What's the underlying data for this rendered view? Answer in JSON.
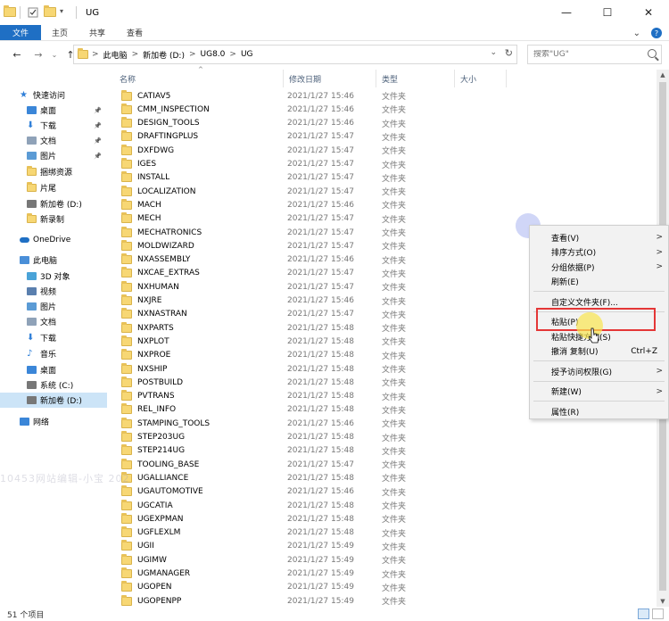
{
  "window": {
    "title": "UG",
    "minimize": "—",
    "maximize": "☐",
    "close": "✕"
  },
  "ribbon": {
    "tabs": [
      "文件",
      "主页",
      "共享",
      "查看"
    ],
    "expand": "⌄",
    "help": "?"
  },
  "address": {
    "crumbs": [
      "此电脑",
      "新加卷 (D:)",
      "UG8.0",
      "UG"
    ],
    "sep": ">",
    "search_placeholder": "搜索\"UG\""
  },
  "nav": {
    "items": [
      {
        "label": "快速访问",
        "icon": "star-icon",
        "pinned": false
      },
      {
        "label": "桌面",
        "icon": "desktop-icon",
        "pinned": true
      },
      {
        "label": "下载",
        "icon": "download-icon",
        "pinned": true
      },
      {
        "label": "文档",
        "icon": "document-icon",
        "pinned": true
      },
      {
        "label": "图片",
        "icon": "picture-icon",
        "pinned": true
      },
      {
        "label": "捆绑资源",
        "icon": "folder-icon",
        "pinned": false
      },
      {
        "label": "片尾",
        "icon": "folder-icon",
        "pinned": false
      },
      {
        "label": "新加卷 (D:)",
        "icon": "drive-icon",
        "pinned": false
      },
      {
        "label": "新录制",
        "icon": "folder-icon",
        "pinned": false
      },
      {
        "label": "OneDrive",
        "icon": "cloud-icon",
        "pinned": false
      },
      {
        "label": "此电脑",
        "icon": "computer-icon",
        "pinned": false
      },
      {
        "label": "3D 对象",
        "icon": "cube-icon",
        "pinned": false
      },
      {
        "label": "视频",
        "icon": "video-icon",
        "pinned": false
      },
      {
        "label": "图片",
        "icon": "picture-icon",
        "pinned": false
      },
      {
        "label": "文档",
        "icon": "document-icon",
        "pinned": false
      },
      {
        "label": "下载",
        "icon": "download-icon",
        "pinned": false
      },
      {
        "label": "音乐",
        "icon": "music-icon",
        "pinned": false
      },
      {
        "label": "桌面",
        "icon": "desktop-icon",
        "pinned": false
      },
      {
        "label": "系统 (C:)",
        "icon": "drive-icon",
        "pinned": false
      },
      {
        "label": "新加卷 (D:)",
        "icon": "drive-icon",
        "pinned": false,
        "selected": true
      },
      {
        "label": "网络",
        "icon": "network-icon",
        "pinned": false
      }
    ]
  },
  "columns": {
    "name": "名称",
    "date": "修改日期",
    "type": "类型",
    "size": "大小"
  },
  "files": [
    {
      "name": "CATIAV5",
      "date": "2021/1/27 15:46",
      "type": "文件夹"
    },
    {
      "name": "CMM_INSPECTION",
      "date": "2021/1/27 15:46",
      "type": "文件夹"
    },
    {
      "name": "DESIGN_TOOLS",
      "date": "2021/1/27 15:46",
      "type": "文件夹"
    },
    {
      "name": "DRAFTINGPLUS",
      "date": "2021/1/27 15:47",
      "type": "文件夹"
    },
    {
      "name": "DXFDWG",
      "date": "2021/1/27 15:47",
      "type": "文件夹"
    },
    {
      "name": "IGES",
      "date": "2021/1/27 15:47",
      "type": "文件夹"
    },
    {
      "name": "INSTALL",
      "date": "2021/1/27 15:47",
      "type": "文件夹"
    },
    {
      "name": "LOCALIZATION",
      "date": "2021/1/27 15:47",
      "type": "文件夹"
    },
    {
      "name": "MACH",
      "date": "2021/1/27 15:46",
      "type": "文件夹"
    },
    {
      "name": "MECH",
      "date": "2021/1/27 15:47",
      "type": "文件夹"
    },
    {
      "name": "MECHATRONICS",
      "date": "2021/1/27 15:47",
      "type": "文件夹"
    },
    {
      "name": "MOLDWIZARD",
      "date": "2021/1/27 15:47",
      "type": "文件夹"
    },
    {
      "name": "NXASSEMBLY",
      "date": "2021/1/27 15:46",
      "type": "文件夹"
    },
    {
      "name": "NXCAE_EXTRAS",
      "date": "2021/1/27 15:47",
      "type": "文件夹"
    },
    {
      "name": "NXHUMAN",
      "date": "2021/1/27 15:47",
      "type": "文件夹"
    },
    {
      "name": "NXJRE",
      "date": "2021/1/27 15:46",
      "type": "文件夹"
    },
    {
      "name": "NXNASTRAN",
      "date": "2021/1/27 15:47",
      "type": "文件夹"
    },
    {
      "name": "NXPARTS",
      "date": "2021/1/27 15:48",
      "type": "文件夹"
    },
    {
      "name": "NXPLOT",
      "date": "2021/1/27 15:48",
      "type": "文件夹"
    },
    {
      "name": "NXPROE",
      "date": "2021/1/27 15:48",
      "type": "文件夹"
    },
    {
      "name": "NXSHIP",
      "date": "2021/1/27 15:48",
      "type": "文件夹"
    },
    {
      "name": "POSTBUILD",
      "date": "2021/1/27 15:48",
      "type": "文件夹"
    },
    {
      "name": "PVTRANS",
      "date": "2021/1/27 15:48",
      "type": "文件夹"
    },
    {
      "name": "REL_INFO",
      "date": "2021/1/27 15:48",
      "type": "文件夹"
    },
    {
      "name": "STAMPING_TOOLS",
      "date": "2021/1/27 15:46",
      "type": "文件夹"
    },
    {
      "name": "STEP203UG",
      "date": "2021/1/27 15:48",
      "type": "文件夹"
    },
    {
      "name": "STEP214UG",
      "date": "2021/1/27 15:48",
      "type": "文件夹"
    },
    {
      "name": "TOOLING_BASE",
      "date": "2021/1/27 15:47",
      "type": "文件夹"
    },
    {
      "name": "UGALLIANCE",
      "date": "2021/1/27 15:48",
      "type": "文件夹"
    },
    {
      "name": "UGAUTOMOTIVE",
      "date": "2021/1/27 15:46",
      "type": "文件夹"
    },
    {
      "name": "UGCATIA",
      "date": "2021/1/27 15:48",
      "type": "文件夹"
    },
    {
      "name": "UGEXPMAN",
      "date": "2021/1/27 15:48",
      "type": "文件夹"
    },
    {
      "name": "UGFLEXLM",
      "date": "2021/1/27 15:48",
      "type": "文件夹"
    },
    {
      "name": "UGII",
      "date": "2021/1/27 15:49",
      "type": "文件夹"
    },
    {
      "name": "UGIMW",
      "date": "2021/1/27 15:49",
      "type": "文件夹"
    },
    {
      "name": "UGMANAGER",
      "date": "2021/1/27 15:49",
      "type": "文件夹"
    },
    {
      "name": "UGOPEN",
      "date": "2021/1/27 15:49",
      "type": "文件夹"
    },
    {
      "name": "UGOPENPP",
      "date": "2021/1/27 15:49",
      "type": "文件夹"
    }
  ],
  "context_menu": {
    "items": [
      {
        "label": "查看(V)",
        "submenu": true
      },
      {
        "label": "排序方式(O)",
        "submenu": true
      },
      {
        "label": "分组依据(P)",
        "submenu": true
      },
      {
        "label": "刷新(E)",
        "submenu": false
      },
      {
        "sep": true
      },
      {
        "label": "自定义文件夹(F)...",
        "submenu": false
      },
      {
        "sep": true
      },
      {
        "label": "粘贴(P)",
        "submenu": false,
        "highlighted": true
      },
      {
        "label": "粘贴快捷方式(S)",
        "submenu": false
      },
      {
        "label": "撤消 复制(U)",
        "submenu": false,
        "shortcut": "Ctrl+Z"
      },
      {
        "sep": true
      },
      {
        "label": "授予访问权限(G)",
        "submenu": true
      },
      {
        "sep": true
      },
      {
        "label": "新建(W)",
        "submenu": true
      },
      {
        "sep": true
      },
      {
        "label": "属性(R)",
        "submenu": false
      }
    ]
  },
  "status": {
    "item_count": "51 个项目"
  },
  "watermark": "10453网站编辑-小宝 202",
  "colors": {
    "accent": "#1f6fc4",
    "selection": "#cce4f7",
    "highlight_box": "#e43636",
    "folder": "#f7d774"
  }
}
